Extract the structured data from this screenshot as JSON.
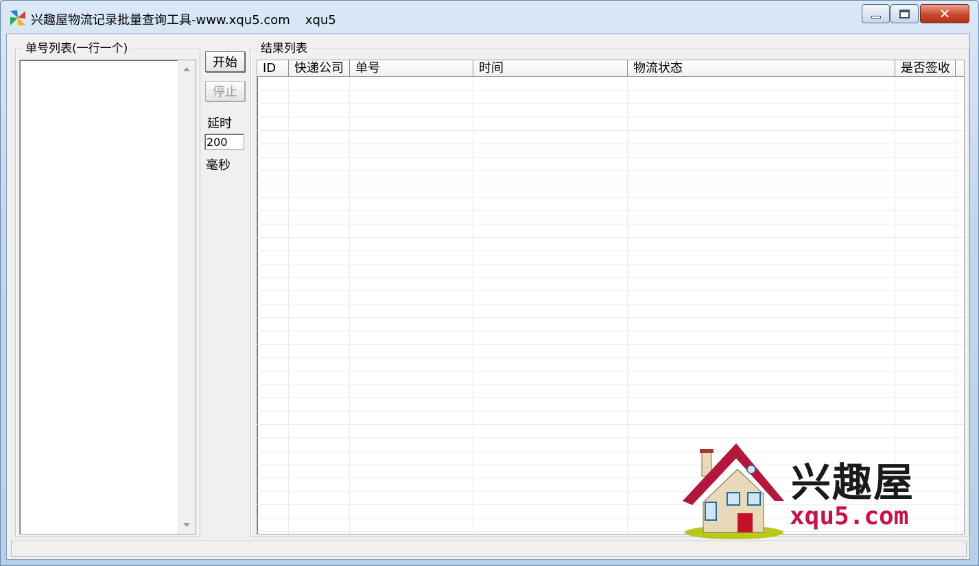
{
  "window": {
    "title": "兴趣屋物流记录批量查询工具-www.xqu5.com",
    "subtitle": "xqu5",
    "controls": {
      "close": "✕"
    }
  },
  "order_list": {
    "label": "单号列表(一行一个)",
    "value": ""
  },
  "controls": {
    "start_label": "开始",
    "stop_label": "停止",
    "delay_label": "延时",
    "delay_value": "200",
    "unit_label": "毫秒"
  },
  "results": {
    "label": "结果列表",
    "columns": [
      "ID",
      "快递公司",
      "单号",
      "时间",
      "物流状态",
      "是否签收"
    ]
  },
  "watermark": {
    "name": "兴趣屋",
    "domain": "xqu5.com"
  },
  "colors": {
    "brand": "#c5134a",
    "titlebar": "#c3d6ee",
    "close": "#c9472d"
  }
}
